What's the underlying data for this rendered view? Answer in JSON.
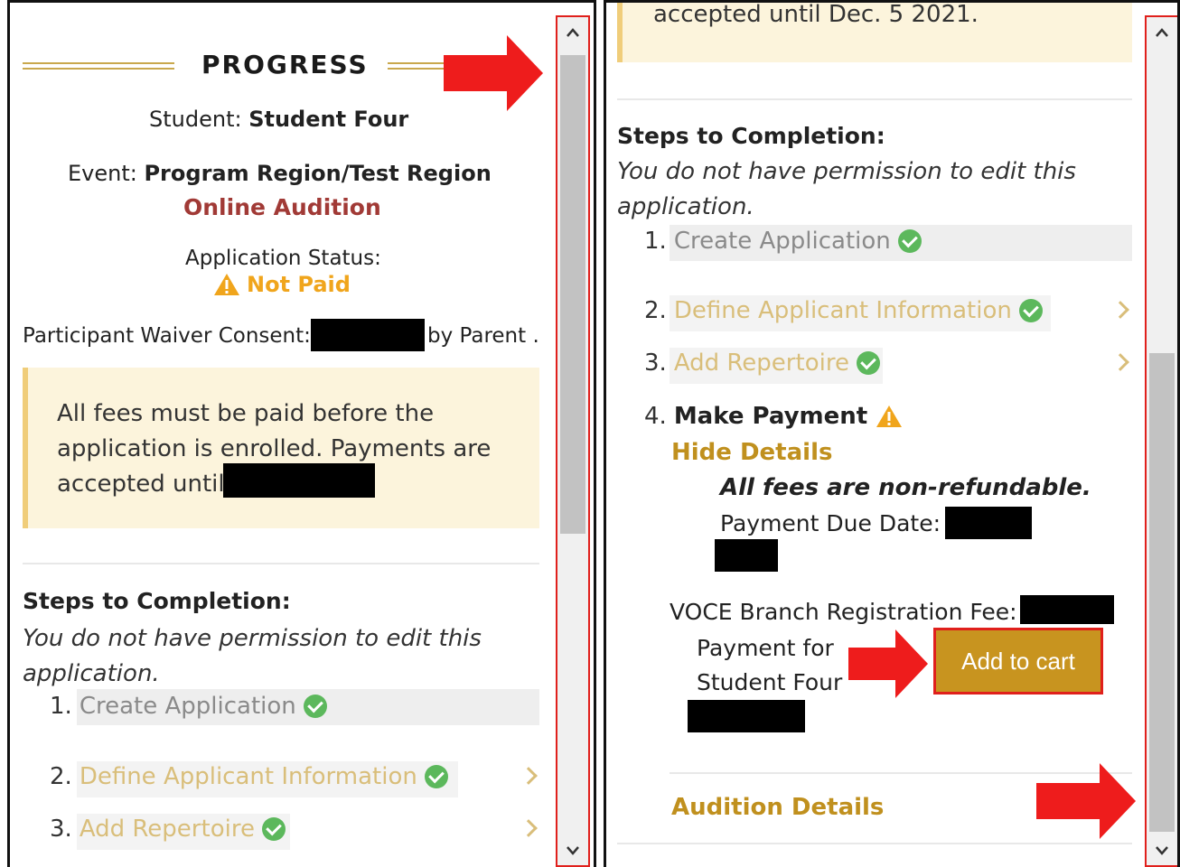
{
  "left": {
    "title": "PROGRESS",
    "student_label": "Student: ",
    "student_name": "Student Four",
    "event_label": "Event: ",
    "event_name": "Program Region/Test Region",
    "event_type": "Online Audition",
    "status_label": "Application Status:",
    "status_value": "Not Paid",
    "waiver_label": "Participant Waiver Consent:",
    "waiver_suffix": "by Parent .",
    "notice_text": "All fees must be paid before the application is enrolled. Payments are accepted until",
    "steps_heading": "Steps to Completion:",
    "permission_note": "You do not have permission to edit this application.",
    "steps": [
      {
        "num": "1.",
        "label": "Create Application"
      },
      {
        "num": "2.",
        "label": "Define Applicant Information"
      },
      {
        "num": "3.",
        "label": "Add Repertoire"
      }
    ]
  },
  "right": {
    "notice_tail": "accepted until Dec. 5 2021.",
    "steps_heading": "Steps to Completion:",
    "permission_note": "You do not have permission to edit this application.",
    "steps": [
      {
        "num": "1.",
        "label": "Create Application"
      },
      {
        "num": "2.",
        "label": "Define Applicant Information"
      },
      {
        "num": "3.",
        "label": "Add Repertoire"
      },
      {
        "num": "4.",
        "label": "Make Payment"
      }
    ],
    "hide_details": "Hide Details",
    "non_refundable": "All fees are non-refundable.",
    "due_date_label": "Payment Due Date:",
    "fee_label": "VOCE Branch Registration Fee:",
    "payment_for_line1": "Payment for",
    "payment_for_line2": "Student Four",
    "add_to_cart": "Add to cart",
    "audition_details": "Audition Details"
  },
  "icons": {
    "status": "warning-triangle-icon",
    "step_done": "check-circle-icon",
    "step_pending": "warning-triangle-icon",
    "expand": "chevron-right-icon",
    "annotation": "red-arrow-icon"
  },
  "colors": {
    "gold": "#c0901e",
    "gold_light": "#d9be7a",
    "maroon": "#a13a36",
    "warning": "#f0a51c",
    "success": "#5cb85c",
    "notice_bg": "#fcf4dc",
    "annotation_red": "#e0201c"
  }
}
